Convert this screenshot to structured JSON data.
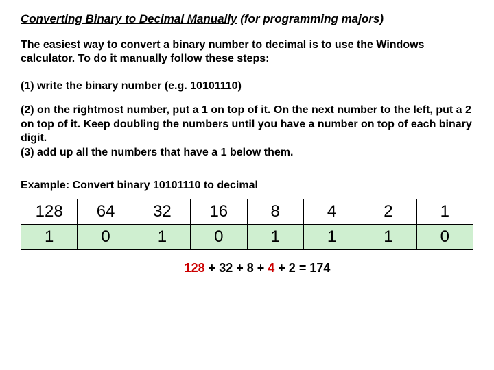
{
  "title_underlined": "Converting Binary to Decimal Manually",
  "title_rest": " (for programming majors)",
  "intro": "The easiest way to convert a binary number to decimal is to use the Windows calculator.  To do it manually follow these steps:",
  "step1": "(1)  write the binary number (e.g. 10101110)",
  "step2": "(2)  on the rightmost number, put a 1 on top of it.  On the next number to the left, put a 2 on top of it.  Keep doubling the numbers until you have a number on top of each binary digit.",
  "step3": "(3)  add up all the numbers that have a 1 below them.",
  "example_label": "Example: Convert binary 10101110 to decimal",
  "table": {
    "powers": [
      "128",
      "64",
      "32",
      "16",
      "8",
      "4",
      "2",
      "1"
    ],
    "bits": [
      "1",
      "0",
      "1",
      "0",
      "1",
      "1",
      "1",
      "0"
    ]
  },
  "sum": {
    "parts": [
      "128",
      " + ",
      "32",
      " + ",
      "8",
      " + ",
      "4",
      " + ",
      "2",
      " = 174"
    ],
    "red_indices": [
      0,
      6
    ]
  }
}
